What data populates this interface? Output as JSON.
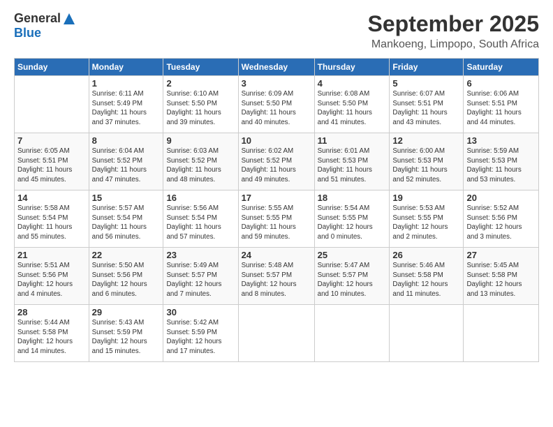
{
  "header": {
    "logo_general": "General",
    "logo_blue": "Blue",
    "month": "September 2025",
    "location": "Mankoeng, Limpopo, South Africa"
  },
  "days_of_week": [
    "Sunday",
    "Monday",
    "Tuesday",
    "Wednesday",
    "Thursday",
    "Friday",
    "Saturday"
  ],
  "weeks": [
    [
      {
        "day": "",
        "info": ""
      },
      {
        "day": "1",
        "info": "Sunrise: 6:11 AM\nSunset: 5:49 PM\nDaylight: 11 hours\nand 37 minutes."
      },
      {
        "day": "2",
        "info": "Sunrise: 6:10 AM\nSunset: 5:50 PM\nDaylight: 11 hours\nand 39 minutes."
      },
      {
        "day": "3",
        "info": "Sunrise: 6:09 AM\nSunset: 5:50 PM\nDaylight: 11 hours\nand 40 minutes."
      },
      {
        "day": "4",
        "info": "Sunrise: 6:08 AM\nSunset: 5:50 PM\nDaylight: 11 hours\nand 41 minutes."
      },
      {
        "day": "5",
        "info": "Sunrise: 6:07 AM\nSunset: 5:51 PM\nDaylight: 11 hours\nand 43 minutes."
      },
      {
        "day": "6",
        "info": "Sunrise: 6:06 AM\nSunset: 5:51 PM\nDaylight: 11 hours\nand 44 minutes."
      }
    ],
    [
      {
        "day": "7",
        "info": "Sunrise: 6:05 AM\nSunset: 5:51 PM\nDaylight: 11 hours\nand 45 minutes."
      },
      {
        "day": "8",
        "info": "Sunrise: 6:04 AM\nSunset: 5:52 PM\nDaylight: 11 hours\nand 47 minutes."
      },
      {
        "day": "9",
        "info": "Sunrise: 6:03 AM\nSunset: 5:52 PM\nDaylight: 11 hours\nand 48 minutes."
      },
      {
        "day": "10",
        "info": "Sunrise: 6:02 AM\nSunset: 5:52 PM\nDaylight: 11 hours\nand 49 minutes."
      },
      {
        "day": "11",
        "info": "Sunrise: 6:01 AM\nSunset: 5:53 PM\nDaylight: 11 hours\nand 51 minutes."
      },
      {
        "day": "12",
        "info": "Sunrise: 6:00 AM\nSunset: 5:53 PM\nDaylight: 11 hours\nand 52 minutes."
      },
      {
        "day": "13",
        "info": "Sunrise: 5:59 AM\nSunset: 5:53 PM\nDaylight: 11 hours\nand 53 minutes."
      }
    ],
    [
      {
        "day": "14",
        "info": "Sunrise: 5:58 AM\nSunset: 5:54 PM\nDaylight: 11 hours\nand 55 minutes."
      },
      {
        "day": "15",
        "info": "Sunrise: 5:57 AM\nSunset: 5:54 PM\nDaylight: 11 hours\nand 56 minutes."
      },
      {
        "day": "16",
        "info": "Sunrise: 5:56 AM\nSunset: 5:54 PM\nDaylight: 11 hours\nand 57 minutes."
      },
      {
        "day": "17",
        "info": "Sunrise: 5:55 AM\nSunset: 5:55 PM\nDaylight: 11 hours\nand 59 minutes."
      },
      {
        "day": "18",
        "info": "Sunrise: 5:54 AM\nSunset: 5:55 PM\nDaylight: 12 hours\nand 0 minutes."
      },
      {
        "day": "19",
        "info": "Sunrise: 5:53 AM\nSunset: 5:55 PM\nDaylight: 12 hours\nand 2 minutes."
      },
      {
        "day": "20",
        "info": "Sunrise: 5:52 AM\nSunset: 5:56 PM\nDaylight: 12 hours\nand 3 minutes."
      }
    ],
    [
      {
        "day": "21",
        "info": "Sunrise: 5:51 AM\nSunset: 5:56 PM\nDaylight: 12 hours\nand 4 minutes."
      },
      {
        "day": "22",
        "info": "Sunrise: 5:50 AM\nSunset: 5:56 PM\nDaylight: 12 hours\nand 6 minutes."
      },
      {
        "day": "23",
        "info": "Sunrise: 5:49 AM\nSunset: 5:57 PM\nDaylight: 12 hours\nand 7 minutes."
      },
      {
        "day": "24",
        "info": "Sunrise: 5:48 AM\nSunset: 5:57 PM\nDaylight: 12 hours\nand 8 minutes."
      },
      {
        "day": "25",
        "info": "Sunrise: 5:47 AM\nSunset: 5:57 PM\nDaylight: 12 hours\nand 10 minutes."
      },
      {
        "day": "26",
        "info": "Sunrise: 5:46 AM\nSunset: 5:58 PM\nDaylight: 12 hours\nand 11 minutes."
      },
      {
        "day": "27",
        "info": "Sunrise: 5:45 AM\nSunset: 5:58 PM\nDaylight: 12 hours\nand 13 minutes."
      }
    ],
    [
      {
        "day": "28",
        "info": "Sunrise: 5:44 AM\nSunset: 5:58 PM\nDaylight: 12 hours\nand 14 minutes."
      },
      {
        "day": "29",
        "info": "Sunrise: 5:43 AM\nSunset: 5:59 PM\nDaylight: 12 hours\nand 15 minutes."
      },
      {
        "day": "30",
        "info": "Sunrise: 5:42 AM\nSunset: 5:59 PM\nDaylight: 12 hours\nand 17 minutes."
      },
      {
        "day": "",
        "info": ""
      },
      {
        "day": "",
        "info": ""
      },
      {
        "day": "",
        "info": ""
      },
      {
        "day": "",
        "info": ""
      }
    ]
  ]
}
